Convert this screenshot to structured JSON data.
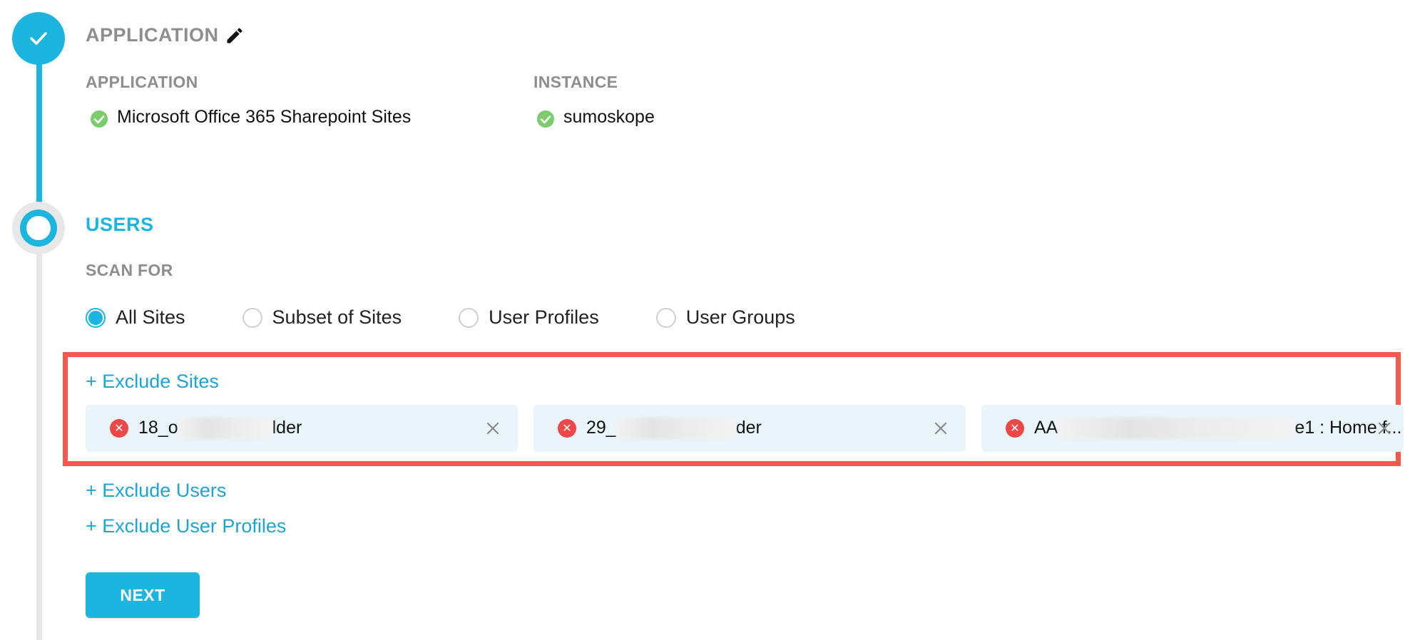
{
  "steps": {
    "application": {
      "title": "APPLICATION",
      "application_label": "APPLICATION",
      "application_value": "Microsoft Office 365 Sharepoint Sites",
      "instance_label": "INSTANCE",
      "instance_value": "sumoskope"
    },
    "users": {
      "title": "USERS",
      "scan_for_label": "SCAN FOR",
      "options": [
        {
          "label": "All Sites",
          "selected": true
        },
        {
          "label": "Subset of Sites",
          "selected": false
        },
        {
          "label": "User Profiles",
          "selected": false
        },
        {
          "label": "User Groups",
          "selected": false
        }
      ],
      "exclude_sites_link": "+ Exclude Sites",
      "excluded_sites": [
        {
          "prefix": "18_o",
          "suffix": "lder"
        },
        {
          "prefix": "29_",
          "suffix": "der"
        },
        {
          "prefix": "AA",
          "suffix": "e1 : Home f..."
        }
      ],
      "exclude_users_link": "+ Exclude Users",
      "exclude_user_profiles_link": "+ Exclude User Profiles",
      "next_button": "NEXT"
    }
  },
  "colors": {
    "accent": "#1cb5e0",
    "highlight": "#f4594c",
    "chip_background": "#e9f5fa",
    "remove_red": "#f04848",
    "ok_green": "#7ccb6d"
  }
}
